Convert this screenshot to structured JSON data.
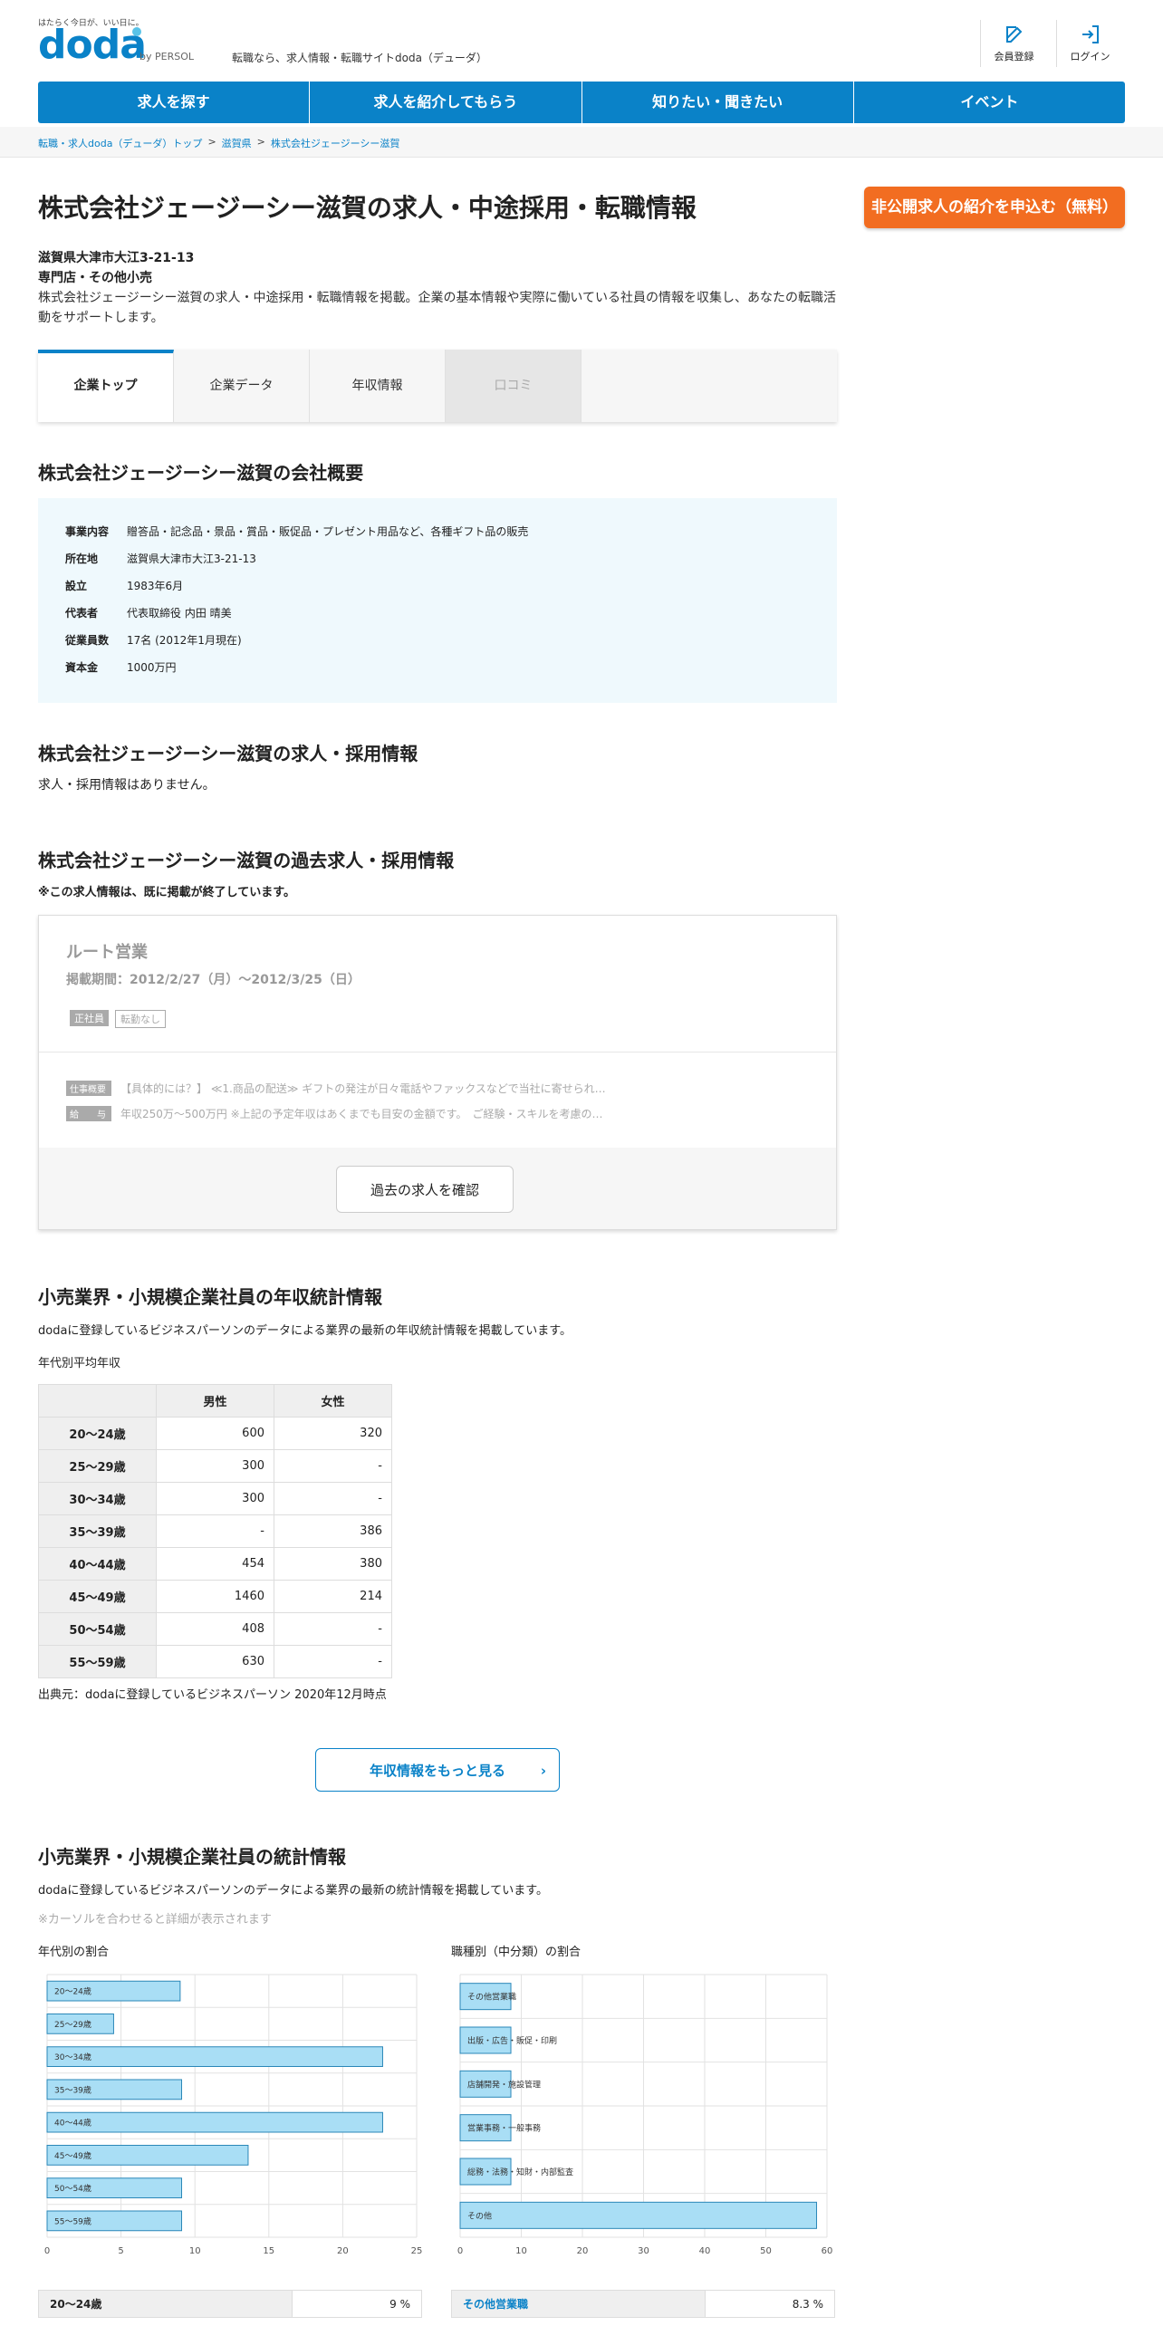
{
  "header": {
    "tagline": "はたらく今日が、いい日に。",
    "logo": "doda",
    "logo_by": "by PERSOL",
    "description": "転職なら、求人情報・転職サイトdoda（デューダ）",
    "register_label": "会員登録",
    "login_label": "ログイン"
  },
  "nav": [
    "求人を探す",
    "求人を紹介してもらう",
    "知りたい・聞きたい",
    "イベント"
  ],
  "breadcrumb": [
    "転職・求人doda（デューダ）トップ",
    "滋賀県",
    "株式会社ジェージーシー滋賀"
  ],
  "company": {
    "title": "株式会社ジェージーシー滋賀の求人・中途採用・転職情報",
    "cta": "非公開求人の紹介を申込む（無料）",
    "address": "滋賀県大津市大江3-21-13",
    "industry": "専門店・その他小売",
    "intro": "株式会社ジェージーシー滋賀の求人・中途採用・転職情報を掲載。企業の基本情報や実際に働いている社員の情報を収集し、あなたの転職活動をサポートします。"
  },
  "tabs": [
    "企業トップ",
    "企業データ",
    "年収情報",
    "口コミ"
  ],
  "overview": {
    "heading": "株式会社ジェージーシー滋賀の会社概要",
    "rows": [
      {
        "k": "事業内容",
        "v": "贈答品・記念品・景品・賞品・販促品・プレゼント用品など、各種ギフト品の販売"
      },
      {
        "k": "所在地",
        "v": "滋賀県大津市大江3-21-13"
      },
      {
        "k": "設立",
        "v": "1983年6月"
      },
      {
        "k": "代表者",
        "v": "代表取締役 内田 晴美"
      },
      {
        "k": "従業員数",
        "v": "17名 (2012年1月現在)"
      },
      {
        "k": "資本金",
        "v": "1000万円"
      }
    ]
  },
  "jobs": {
    "heading": "株式会社ジェージーシー滋賀の求人・採用情報",
    "none": "求人・採用情報はありません。"
  },
  "past": {
    "heading": "株式会社ジェージーシー滋賀の過去求人・採用情報",
    "note": "※この求人情報は、既に掲載が終了しています。",
    "title": "ルート営業",
    "period": "掲載期間：2012/2/27（月）～2012/3/25（日）",
    "badges": [
      "正社員",
      "転勤なし"
    ],
    "summary_label": "仕事概要",
    "summary": "【具体的には？】 ≪1.商品の配送≫ ギフトの発注が日々電話やファックスなどで当社に寄せられ…",
    "salary_label": "給　　与",
    "salary": "年収250万～500万円 ※上記の予定年収はあくまでも目安の金額です。　ご経験・スキルを考慮の…",
    "button": "過去の求人を確認"
  },
  "salary": {
    "heading": "小売業界・小規模企業社員の年収統計情報",
    "desc": "dodaに登録しているビジネスパーソンのデータによる業界の最新の年収統計情報を掲載しています。",
    "caption": "年代別平均年収",
    "cols": [
      "男性",
      "女性"
    ],
    "rows": [
      {
        "age": "20～24歳",
        "m": "600",
        "f": "320"
      },
      {
        "age": "25～29歳",
        "m": "300",
        "f": "-"
      },
      {
        "age": "30～34歳",
        "m": "300",
        "f": "-"
      },
      {
        "age": "35～39歳",
        "m": "-",
        "f": "386"
      },
      {
        "age": "40～44歳",
        "m": "454",
        "f": "380"
      },
      {
        "age": "45～49歳",
        "m": "1460",
        "f": "214"
      },
      {
        "age": "50～54歳",
        "m": "408",
        "f": "-"
      },
      {
        "age": "55～59歳",
        "m": "630",
        "f": "-"
      }
    ],
    "source": "出典元：dodaに登録しているビジネスパーソン 2020年12月時点",
    "more": "年収情報をもっと見る"
  },
  "stats": {
    "heading": "小売業界・小規模企業社員の統計情報",
    "desc": "dodaに登録しているビジネスパーソンのデータによる業界の最新の統計情報を掲載しています。",
    "hint": "※カーソルを合わせると詳細が表示されます",
    "age_caption": "年代別の割合",
    "job_caption": "職種別（中分類）の割合",
    "age_first_row": {
      "label": "20～24歳",
      "value": "9 %"
    },
    "job_first_row": {
      "label": "その他営業職",
      "value": "8.3 %"
    }
  },
  "chart_data": [
    {
      "type": "bar",
      "orientation": "horizontal",
      "categories": [
        "20～24歳",
        "25～29歳",
        "30～34歳",
        "35～39歳",
        "40～44歳",
        "45～49歳",
        "50～54歳",
        "55～59歳"
      ],
      "values": [
        9,
        4.5,
        22.7,
        9.1,
        22.7,
        13.6,
        9.1,
        9.1
      ],
      "xlim": [
        0,
        25
      ],
      "xticks": [
        "0",
        "5",
        "10",
        "15",
        "20",
        "25"
      ],
      "grid": true
    },
    {
      "type": "bar",
      "orientation": "horizontal",
      "categories": [
        "その他営業職",
        "出版・広告・販促・印刷",
        "店舗開発・施設管理",
        "営業事務・一般事務",
        "総務・法務・知財・内部監査",
        "その他"
      ],
      "values": [
        8.3,
        8.3,
        8.3,
        8.3,
        8.3,
        58.3
      ],
      "xlim": [
        0,
        60
      ],
      "xticks": [
        "0",
        "10",
        "20",
        "30",
        "40",
        "50",
        "60"
      ],
      "grid": true
    }
  ],
  "colors": {
    "brand": "#0a82c8",
    "cta": "#f26d21",
    "bar_fill": "#a9def5",
    "bar_stroke": "#2a87b8"
  }
}
